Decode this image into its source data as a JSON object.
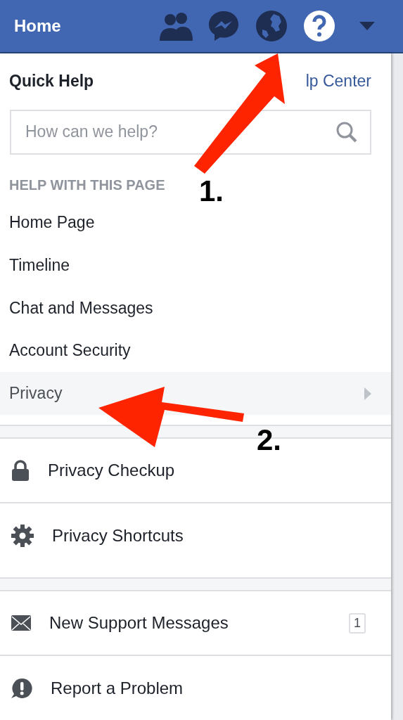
{
  "top_bar": {
    "title": "Home",
    "icons": [
      {
        "kind": "friends",
        "selected": false
      },
      {
        "kind": "messenger",
        "selected": false
      },
      {
        "kind": "globe",
        "selected": false
      },
      {
        "kind": "help",
        "selected": true
      },
      {
        "kind": "caret",
        "selected": false
      }
    ]
  },
  "menu": {
    "title": "Quick Help",
    "link": "lp Center",
    "search": {
      "placeholder": "How can we help?"
    },
    "section_heading": "HELP WITH THIS PAGE",
    "help_items": [
      {
        "label": "Home Page",
        "selected": false
      },
      {
        "label": "Timeline",
        "selected": false
      },
      {
        "label": "Chat and Messages",
        "selected": false
      },
      {
        "label": "Account Security",
        "selected": false
      },
      {
        "label": "Privacy",
        "selected": true
      }
    ],
    "groups": [
      [
        {
          "kind": "lock",
          "label": "Privacy Checkup"
        },
        {
          "kind": "gear",
          "label": "Privacy Shortcuts"
        }
      ],
      [
        {
          "kind": "mail",
          "label": "New Support Messages",
          "count": "1"
        },
        {
          "kind": "alert",
          "label": "Report a Problem"
        }
      ]
    ]
  },
  "annotations": [
    {
      "label": "1."
    },
    {
      "label": "2."
    }
  ]
}
